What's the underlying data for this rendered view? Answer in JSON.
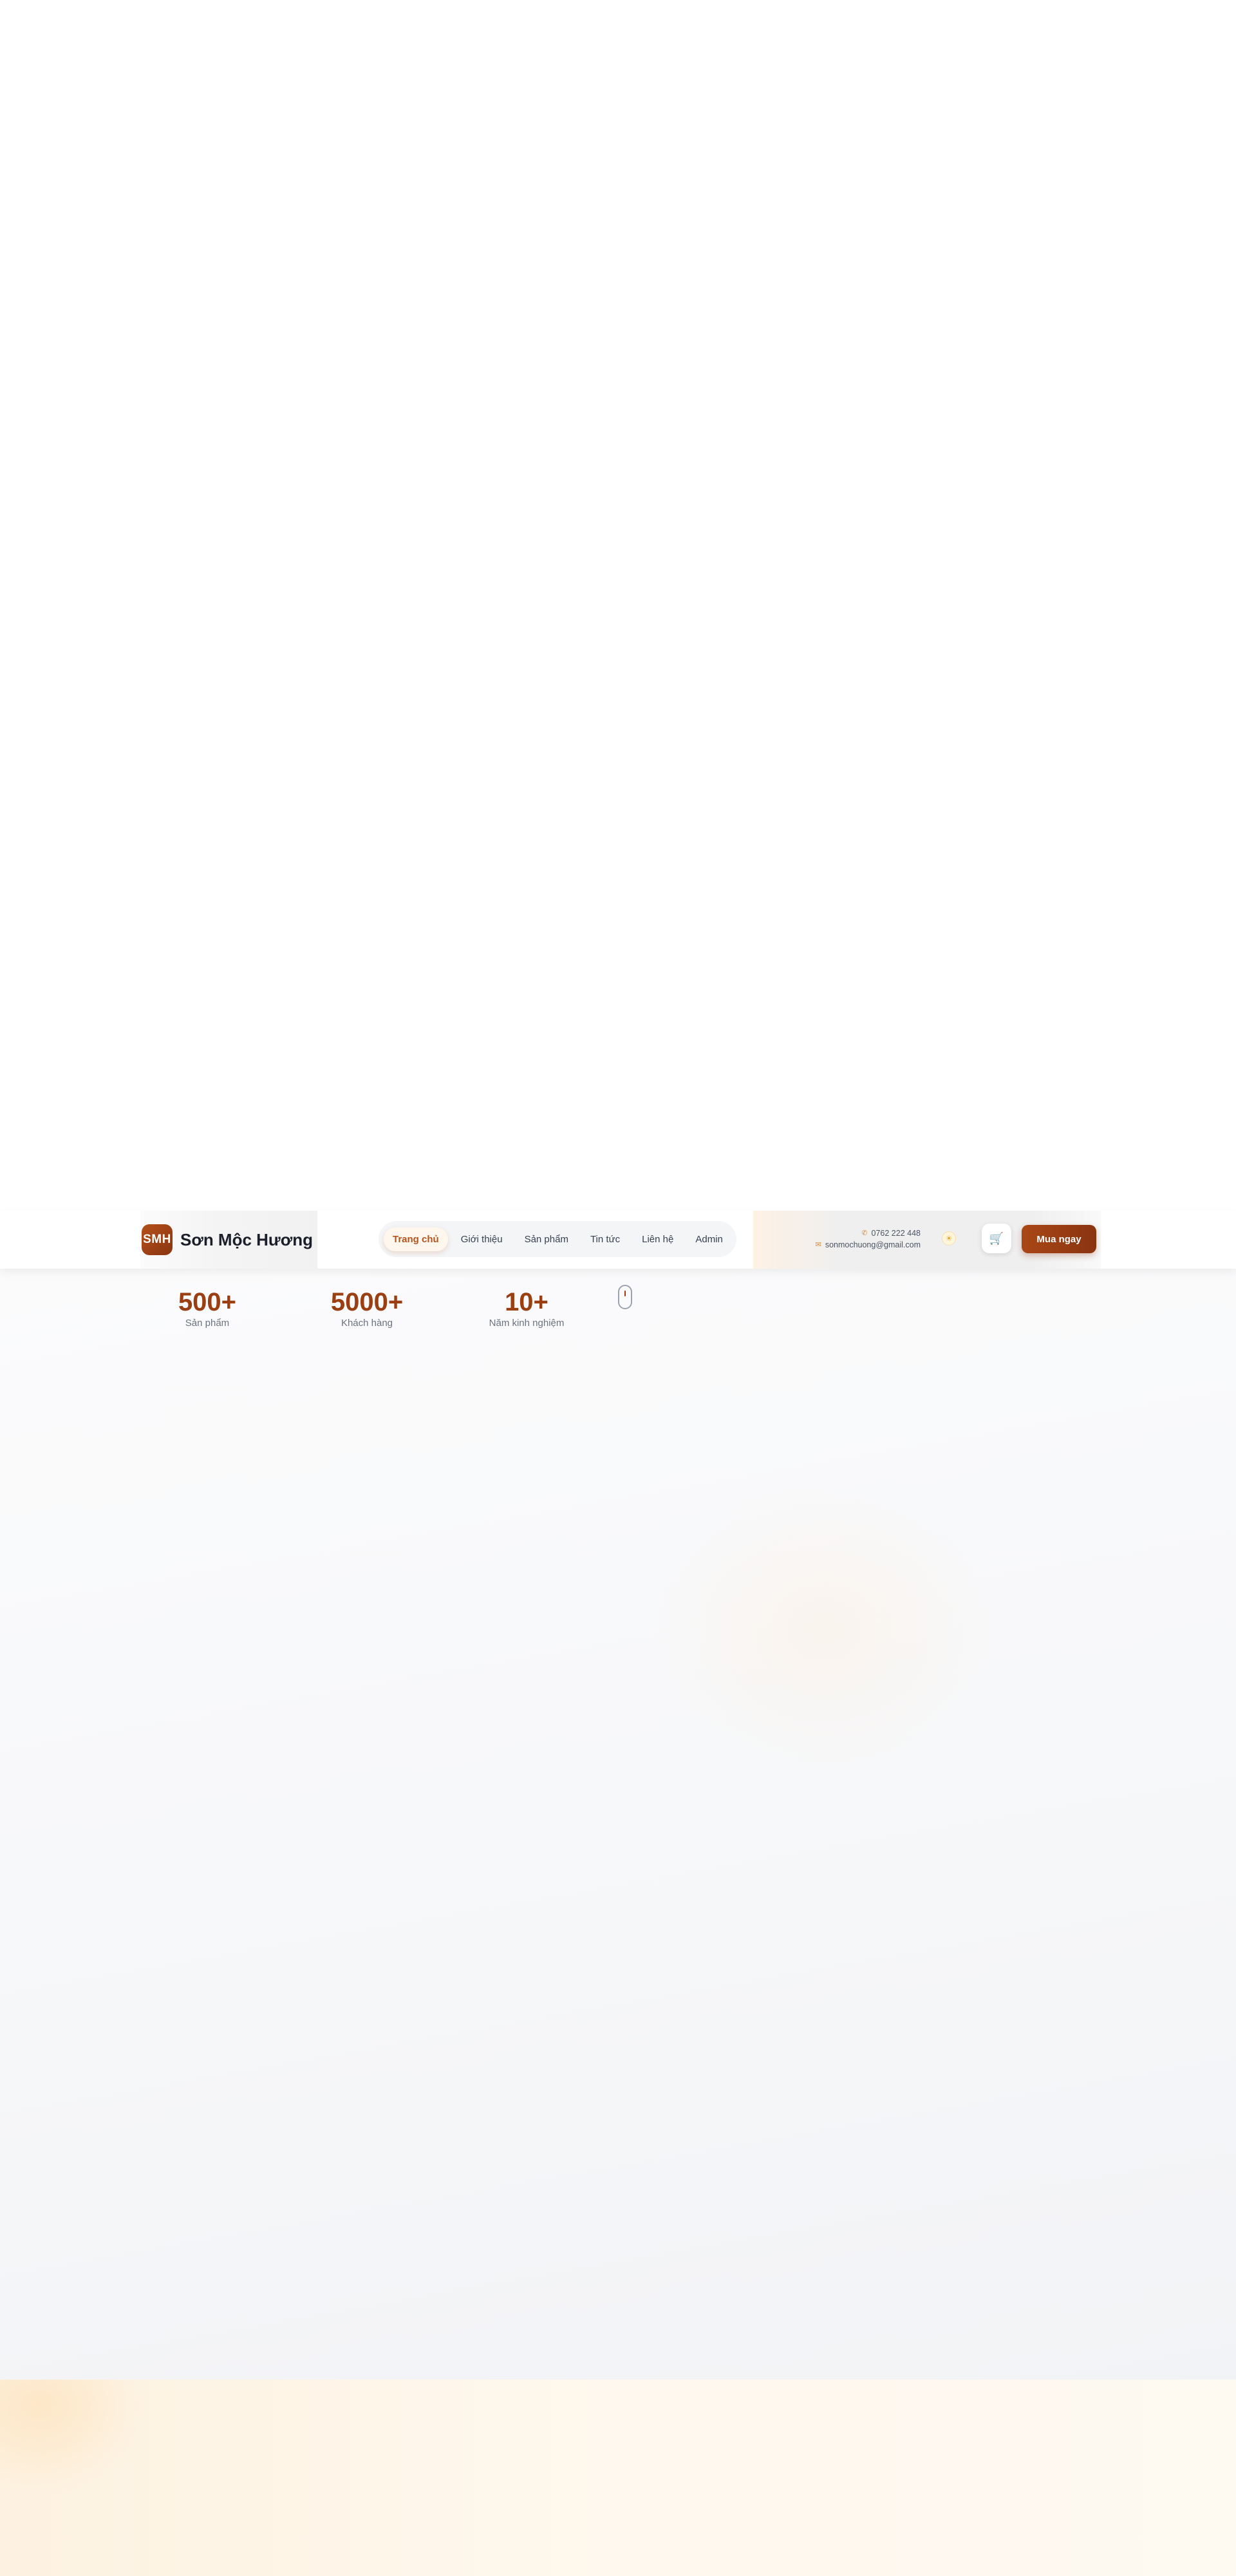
{
  "header": {
    "logo_badge": "SMH",
    "brand_name": "Sơn Mộc Hương",
    "nav": [
      {
        "label": "Trang chủ",
        "active": true
      },
      {
        "label": "Giới thiệu",
        "active": false
      },
      {
        "label": "Sản phẩm",
        "active": false
      },
      {
        "label": "Tin tức",
        "active": false
      },
      {
        "label": "Liên hệ",
        "active": false
      },
      {
        "label": "Admin",
        "active": false
      }
    ],
    "phone": "0762 222 448",
    "email": "sonmochuong@gmail.com",
    "buy_button": "Mua ngay",
    "icons": {
      "phone": "phone-icon",
      "email": "mail-icon",
      "theme": "sun-icon",
      "cart": "cart-icon"
    }
  },
  "stats": [
    {
      "value": "500+",
      "label": "Sản phẩm"
    },
    {
      "value": "5000+",
      "label": "Khách hàng"
    },
    {
      "value": "10+",
      "label": "Năm kinh nghiệm"
    }
  ],
  "colors": {
    "brand": "#9b3f12",
    "accent": "#b5541c",
    "button": "#8a3410"
  }
}
